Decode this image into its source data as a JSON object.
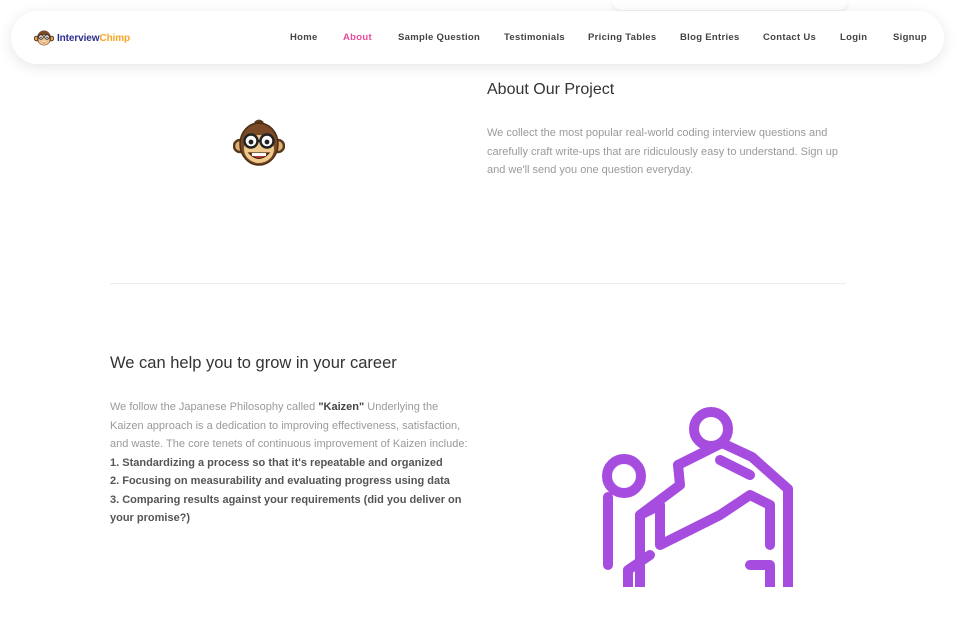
{
  "brand": {
    "name_part1": "Interview",
    "name_part2": "Chimp",
    "color_primary": "#2b2e8c",
    "color_accent": "#f5a623"
  },
  "nav": {
    "active_color": "#e94a9c",
    "items": [
      {
        "label": "Home"
      },
      {
        "label": "About",
        "active": true
      },
      {
        "label": "Sample Question"
      },
      {
        "label": "Testimonials"
      },
      {
        "label": "Pricing Tables"
      },
      {
        "label": "Blog Entries"
      },
      {
        "label": "Contact Us"
      },
      {
        "label": "Login"
      },
      {
        "label": "Signup"
      }
    ]
  },
  "about": {
    "title": "About Our Project",
    "text": "We collect the most popular real-world coding interview questions and carefully craft write-ups that are ridiculously easy to understand. Sign up and we'll send you one question everyday.",
    "image_icon": "chimp-mascot-icon"
  },
  "career": {
    "title": "We can help you to grow in your career",
    "intro_before": "We follow the Japanese Philosophy called ",
    "intro_bold": "\"Kaizen\"",
    "intro_after": " Underlying the Kaizen approach is a dedication to improving effectiveness, satisfaction, and waste. The core tenets of continuous improvement of Kaizen include:",
    "tenets": [
      "1. Standardizing a process so that it's repeatable and organized",
      "2. Focusing on measurability and evaluating progress using data",
      "3. Comparing results against your requirements (did you deliver on your promise?)"
    ],
    "illustration_icon": "helping-hand-climb-icon",
    "illustration_color": "#a64de0"
  }
}
